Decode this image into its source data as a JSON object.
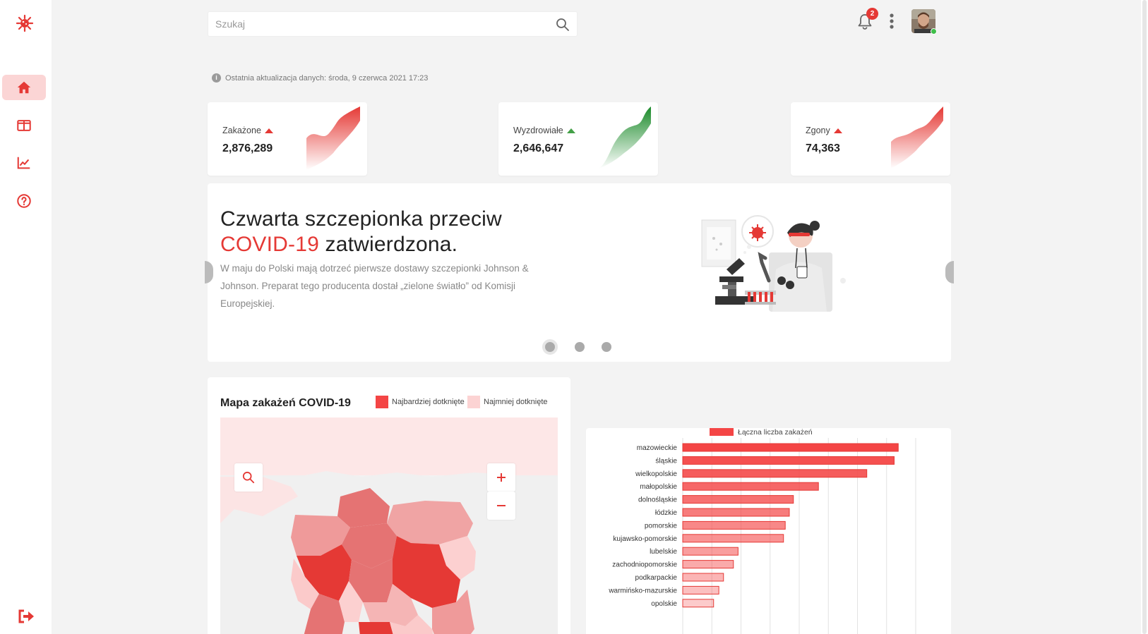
{
  "search": {
    "placeholder": "Szukaj"
  },
  "header": {
    "notification_count": "2"
  },
  "last_update": "Ostatnia aktualizacja danych: środa, 9 czerwca 2021 17:23",
  "stats": [
    {
      "label": "Zakażone",
      "value": "2,876,289",
      "trend": "up",
      "color": "#e53935"
    },
    {
      "label": "Wyzdrowiałe",
      "value": "2,646,647",
      "trend": "up",
      "color": "#2e9e3a"
    },
    {
      "label": "Zgony",
      "value": "74,363",
      "trend": "up",
      "color": "#e53935"
    }
  ],
  "banner": {
    "title_line1": "Czwarta szczepionka przeciw",
    "title_highlight": "COVID-19",
    "title_rest": " zatwierdzona.",
    "text": "W maju do Polski mają dotrzeć pierwsze dostawy szczepionki Johnson & Johnson. Preparat tego producenta dostał „zielone światło” od Komisji Europejskiej.",
    "slides": 3,
    "active_slide": 0
  },
  "map": {
    "title": "Mapa zakażeń COVID-19",
    "legend_most": "Najbardziej dotknięte",
    "legend_least": "Najmniej dotknięte",
    "color_most": "#f44545",
    "color_least": "#fcd3d3"
  },
  "chart_data": {
    "type": "bar",
    "orientation": "horizontal",
    "legend": "Łączna liczba zakażeń",
    "categories": [
      "mazowieckie",
      "śląskie",
      "wielkopolskie",
      "małopolskie",
      "dolnośląskie",
      "łódzkie",
      "pomorskie",
      "kujawsko-pomorskie",
      "lubelskie",
      "zachodniopomorskie",
      "podkarpackie",
      "warmińsko-mazurskie",
      "opolskie"
    ],
    "values": [
      370000,
      363000,
      316000,
      233000,
      190000,
      183000,
      176000,
      173000,
      95000,
      87000,
      70000,
      62000,
      53000
    ],
    "xlim": [
      0,
      400000
    ],
    "grid": true,
    "color": "#f44545"
  }
}
